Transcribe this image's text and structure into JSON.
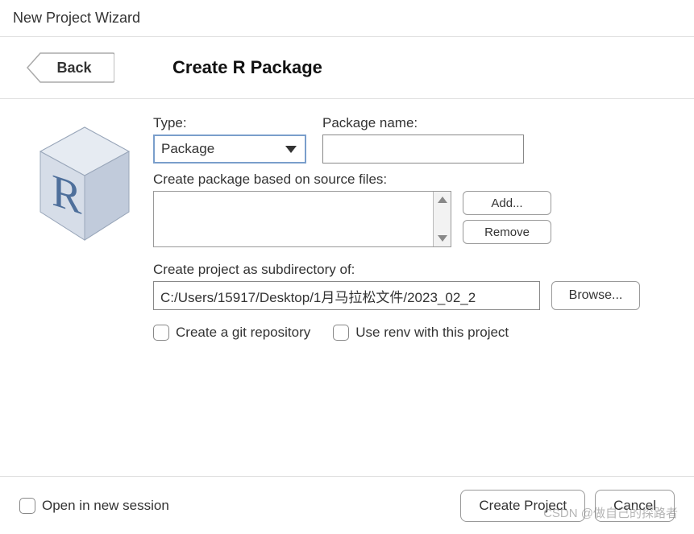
{
  "window": {
    "title": "New Project Wizard"
  },
  "header": {
    "back_label": "Back",
    "page_title": "Create R Package"
  },
  "form": {
    "type_label": "Type:",
    "type_value": "Package",
    "pkgname_label": "Package name:",
    "pkgname_value": "",
    "source_label": "Create package based on source files:",
    "add_label": "Add...",
    "remove_label": "Remove",
    "dir_label": "Create project as subdirectory of:",
    "dir_value": "C:/Users/15917/Desktop/1月马拉松文件/2023_02_2",
    "browse_label": "Browse...",
    "git_label": "Create a git repository",
    "renv_label": "Use renv with this project"
  },
  "footer": {
    "open_new_session": "Open in new session",
    "create_label": "Create Project",
    "cancel_label": "Cancel"
  },
  "watermark": "CSDN @做自己的探路者"
}
